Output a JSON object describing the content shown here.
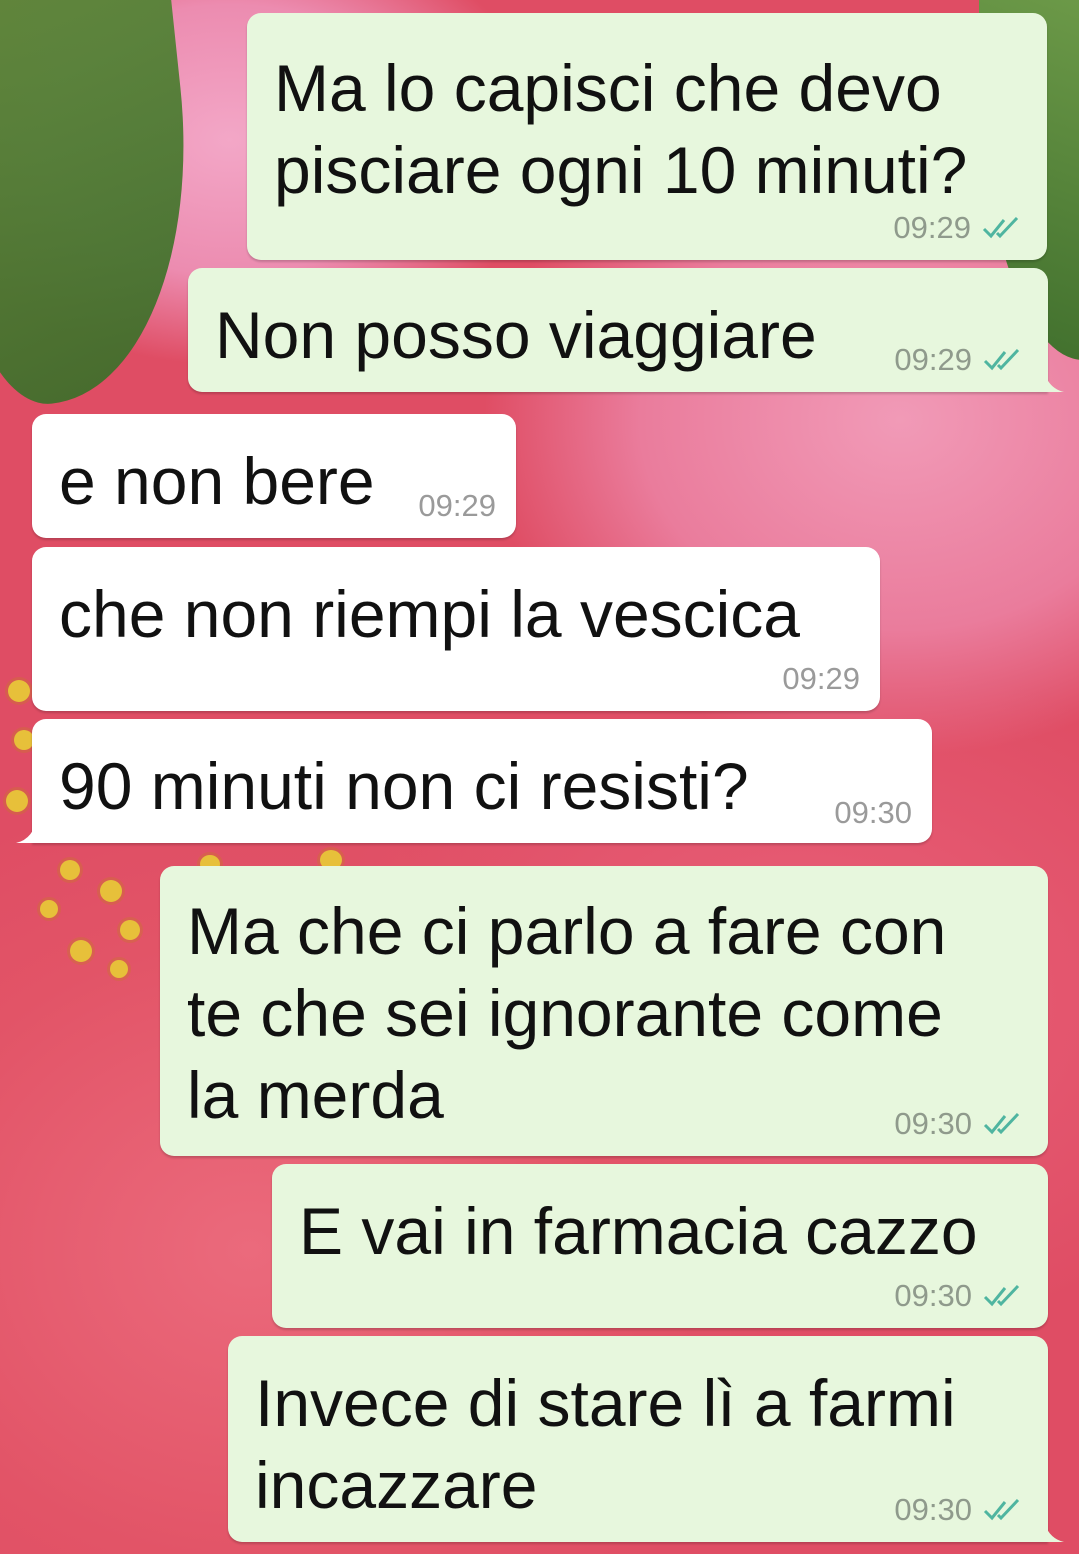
{
  "messages": [
    {
      "direction": "out",
      "text": "Ma lo capisci che devo\npisciare ogni 10 minuti?",
      "time": "09:29",
      "status": "read-double-check-icon"
    },
    {
      "direction": "out",
      "text": "Non posso viaggiare",
      "time": "09:29",
      "status": "read-double-check-icon"
    },
    {
      "direction": "in",
      "text": "e non bere",
      "time": "09:29"
    },
    {
      "direction": "in",
      "text": "che non riempi la vescica",
      "time": "09:29"
    },
    {
      "direction": "in",
      "text": "90 minuti non ci resisti?",
      "time": "09:30"
    },
    {
      "direction": "out",
      "text": "Ma che ci parlo a fare con\nte che sei ignorante come\nla merda",
      "time": "09:30",
      "status": "read-double-check-icon"
    },
    {
      "direction": "out",
      "text": "E vai in farmacia cazzo",
      "time": "09:30",
      "status": "read-double-check-icon"
    },
    {
      "direction": "out",
      "text": "Invece di stare lì a farmi\nincazzare",
      "time": "09:30",
      "status": "read-double-check-icon"
    }
  ],
  "colors": {
    "outgoing_bubble": "#e7f7dd",
    "incoming_bubble": "#ffffff",
    "read_tick": "#4fb5a0",
    "wallpaper": "#e2566b"
  }
}
